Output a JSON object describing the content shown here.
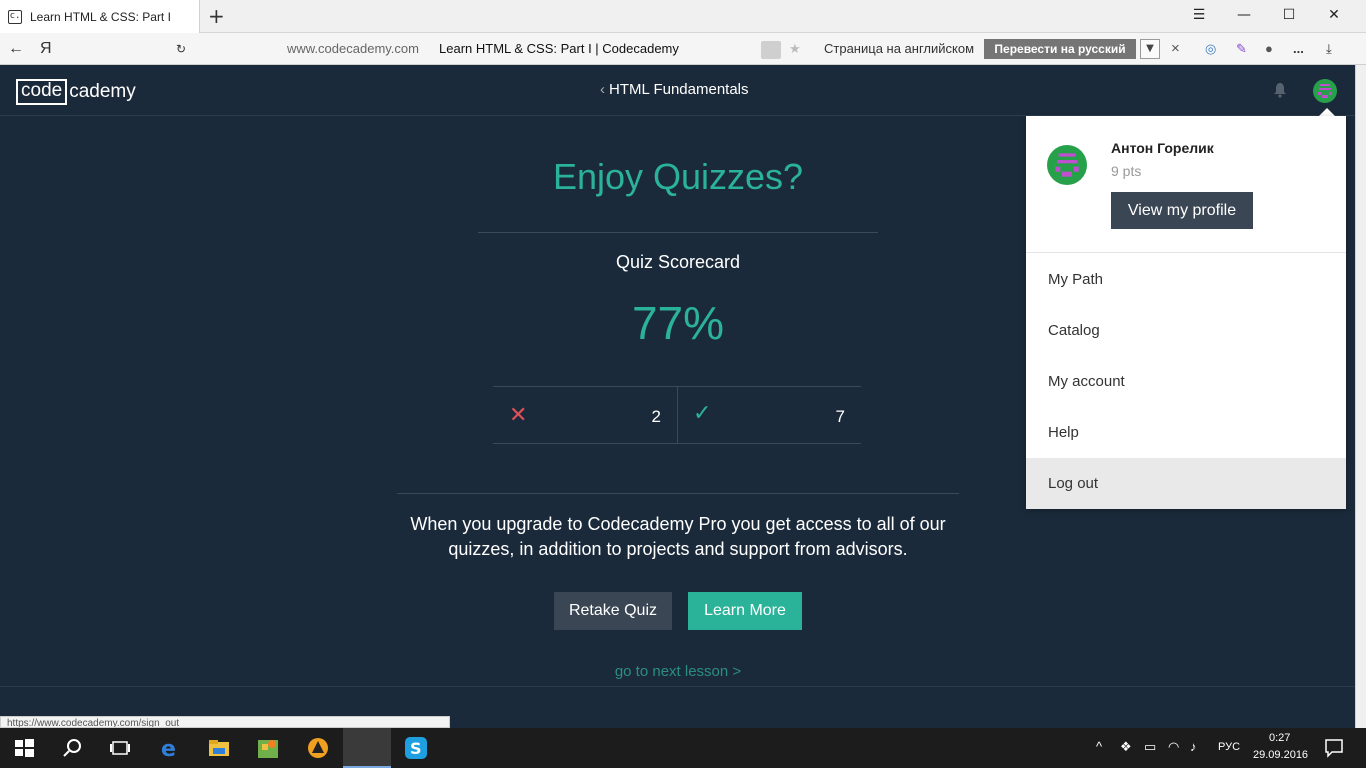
{
  "browser": {
    "tab_title": "Learn HTML & CSS: Part I",
    "favicon_glyph": "c.",
    "new_tab": "+",
    "url_host": "www.codecademy.com",
    "url_title": "Learn HTML & CSS: Part I | Codecademy",
    "yandex_letter": "Я",
    "translate_prompt": "Страница на английском",
    "translate_button": "Перевести на русский",
    "translate_close": "×",
    "more_icon": "..."
  },
  "header": {
    "logo_code": "code",
    "logo_cademy": "cademy",
    "course_title": "HTML Fundamentals"
  },
  "quiz": {
    "heading": "Enjoy Quizzes?",
    "scorecard_label": "Quiz Scorecard",
    "score_percent": "77%",
    "wrong_count": "2",
    "correct_count": "7",
    "upsell_text": "When you upgrade to Codecademy Pro you get access to all of our quizzes, in addition to projects and support from advisors.",
    "retake_label": "Retake Quiz",
    "learn_more_label": "Learn More",
    "next_lesson_label": "go to next lesson >"
  },
  "dropdown": {
    "user_name": "Антон Горелик",
    "points": "9 pts",
    "view_profile_label": "View my profile",
    "items": [
      {
        "label": "My Path"
      },
      {
        "label": "Catalog"
      },
      {
        "label": "My account"
      },
      {
        "label": "Help"
      },
      {
        "label": "Log out"
      }
    ]
  },
  "status_bar_url": "https://www.codecademy.com/sign_out",
  "taskbar": {
    "language": "РУС",
    "time": "0:27",
    "date": "29.09.2016"
  },
  "colors": {
    "accent": "#2bb39a",
    "background": "#1b2a3a",
    "wrong": "#e0505a",
    "button_dark": "#3a4654"
  }
}
